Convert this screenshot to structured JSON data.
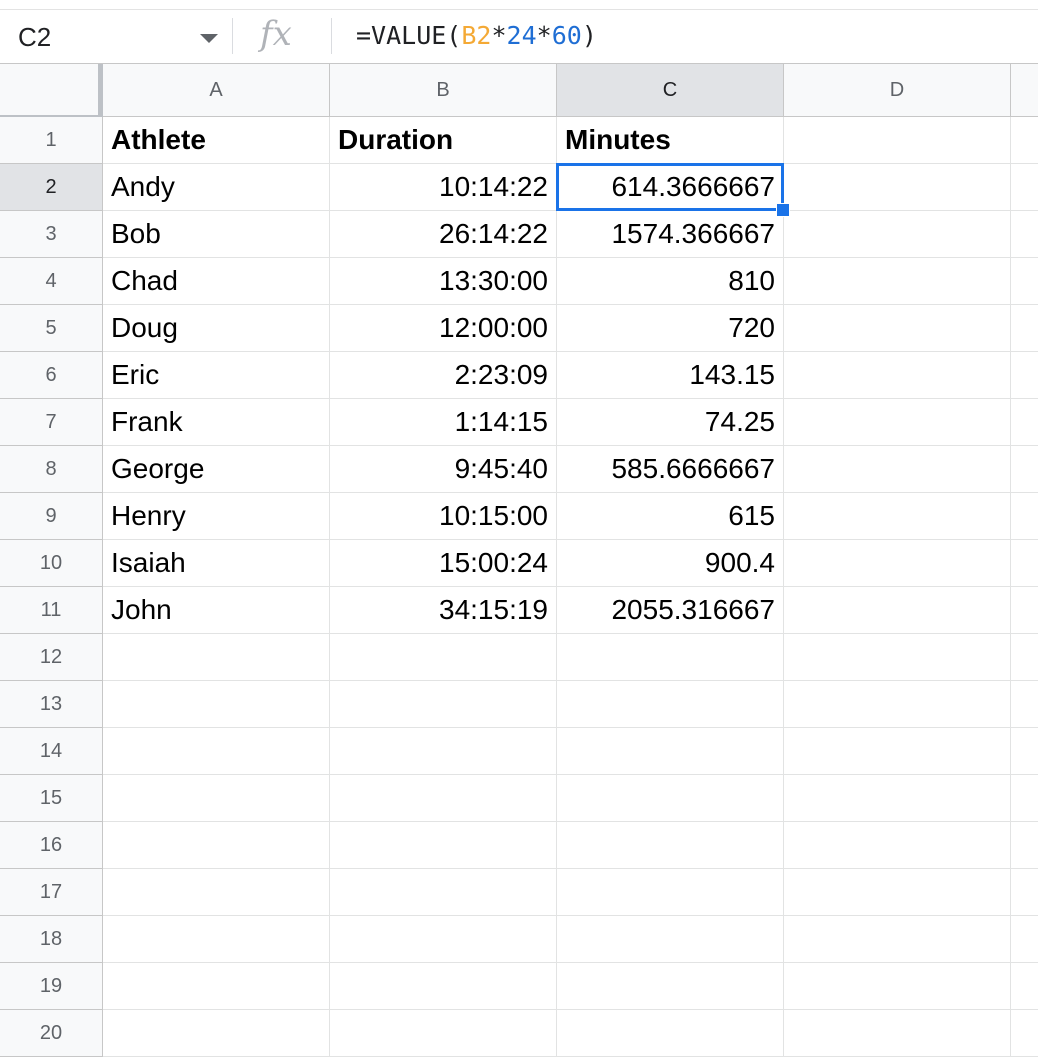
{
  "formula_bar": {
    "name_box": "C2",
    "fx_label": "fx",
    "formula_prefix": "=VALUE(",
    "formula_ref": "B2",
    "formula_op1": "*",
    "formula_num1": "24",
    "formula_op2": "*",
    "formula_num2": "60",
    "formula_suffix": ")"
  },
  "columns": [
    "A",
    "B",
    "C",
    "D"
  ],
  "active_column": "C",
  "active_row": 2,
  "rows": [
    {
      "num": "1",
      "A": "Athlete",
      "B": "Duration",
      "C": "Minutes"
    },
    {
      "num": "2",
      "A": "Andy",
      "B": "10:14:22",
      "C": "614.3666667"
    },
    {
      "num": "3",
      "A": "Bob",
      "B": "26:14:22",
      "C": "1574.366667"
    },
    {
      "num": "4",
      "A": "Chad",
      "B": "13:30:00",
      "C": "810"
    },
    {
      "num": "5",
      "A": "Doug",
      "B": "12:00:00",
      "C": "720"
    },
    {
      "num": "6",
      "A": "Eric",
      "B": "2:23:09",
      "C": "143.15"
    },
    {
      "num": "7",
      "A": "Frank",
      "B": "1:14:15",
      "C": "74.25"
    },
    {
      "num": "8",
      "A": "George",
      "B": "9:45:40",
      "C": "585.6666667"
    },
    {
      "num": "9",
      "A": "Henry",
      "B": "10:15:00",
      "C": "615"
    },
    {
      "num": "10",
      "A": "Isaiah",
      "B": "15:00:24",
      "C": "900.4"
    },
    {
      "num": "11",
      "A": "John",
      "B": "34:15:19",
      "C": "2055.316667"
    },
    {
      "num": "12",
      "A": "",
      "B": "",
      "C": ""
    },
    {
      "num": "13",
      "A": "",
      "B": "",
      "C": ""
    },
    {
      "num": "14",
      "A": "",
      "B": "",
      "C": ""
    },
    {
      "num": "15",
      "A": "",
      "B": "",
      "C": ""
    },
    {
      "num": "16",
      "A": "",
      "B": "",
      "C": ""
    },
    {
      "num": "17",
      "A": "",
      "B": "",
      "C": ""
    },
    {
      "num": "18",
      "A": "",
      "B": "",
      "C": ""
    },
    {
      "num": "19",
      "A": "",
      "B": "",
      "C": ""
    },
    {
      "num": "20",
      "A": "",
      "B": "",
      "C": ""
    }
  ],
  "colors": {
    "selection": "#1a73e8",
    "formula_reference": "#f4a935",
    "formula_number": "#1f6ed4"
  }
}
